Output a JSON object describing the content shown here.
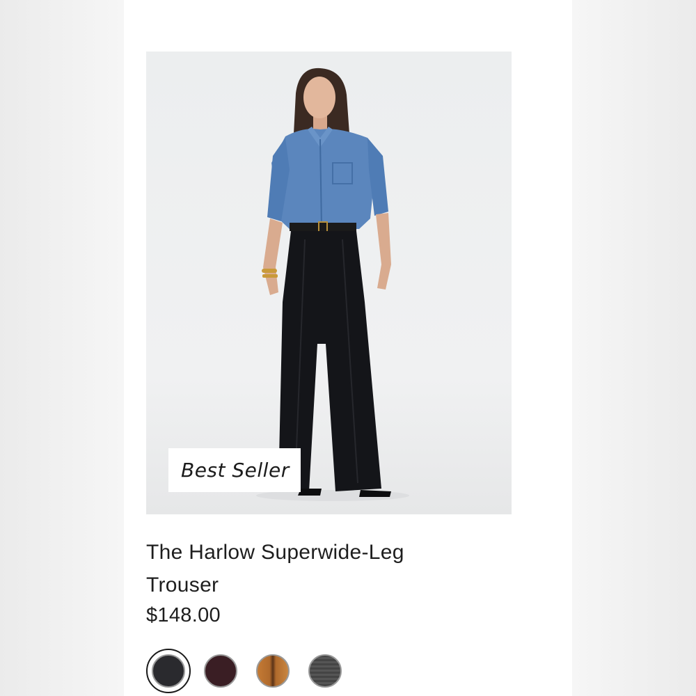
{
  "product": {
    "badge": "Best Seller",
    "title": "The Harlow Superwide-Leg Trouser",
    "price": "$148.00",
    "image_alt": "Model wearing a chambray button-up shirt and black wide-leg trousers"
  },
  "swatches": [
    {
      "name": "swatch-black",
      "color": "#2a2a2e",
      "selected": true
    },
    {
      "name": "swatch-burgundy",
      "color": "#3a1e24",
      "selected": false
    },
    {
      "name": "swatch-camel",
      "color": "#b06a2c",
      "selected": false
    },
    {
      "name": "swatch-grey-plaid",
      "color": "#8b8b8b",
      "selected": false
    }
  ],
  "colors": {
    "background": "#ffffff",
    "text": "#1e1e1e",
    "page_side": "#f1f1f1"
  }
}
